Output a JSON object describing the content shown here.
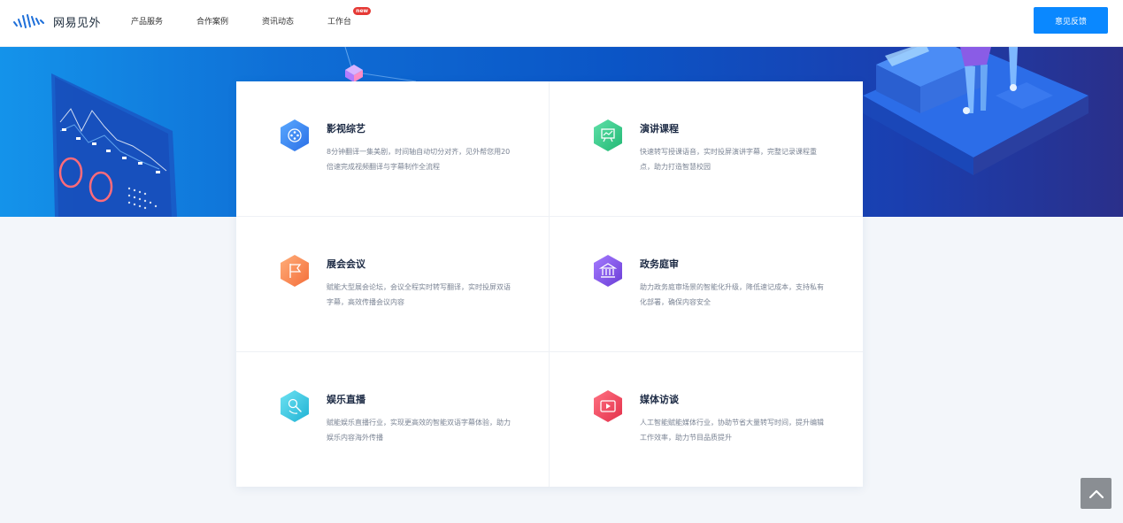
{
  "header": {
    "logo_text": "网易见外",
    "nav": [
      {
        "label": "产品服务"
      },
      {
        "label": "合作案例"
      },
      {
        "label": "资讯动态"
      },
      {
        "label": "工作台",
        "badge": "new"
      }
    ],
    "feedback_label": "意见反馈"
  },
  "cards": [
    {
      "title": "影视综艺",
      "desc": "8分钟翻译一集美剧，时间轴自动切分对齐，见外帮您用20倍速完成视频翻译与字幕制作全流程",
      "icon": "film-reel-icon",
      "color": "#3d8cf0"
    },
    {
      "title": "演讲课程",
      "desc": "快速转写授课语音，实时投屏演讲字幕，完整记录课程重点，助力打造智慧校园",
      "icon": "presentation-board-icon",
      "color": "#3ccf8e"
    },
    {
      "title": "展会会议",
      "desc": "赋能大型展会论坛，会议全程实时转写翻译，实时投屏双语字幕，高效传播会议内容",
      "icon": "flag-icon",
      "color": "#f98a55"
    },
    {
      "title": "政务庭审",
      "desc": "助力政务庭审场景的智能化升级，降低速记成本，支持私有化部署，确保内容安全",
      "icon": "courthouse-icon",
      "color": "#8656e6"
    },
    {
      "title": "娱乐直播",
      "desc": "赋能娱乐直播行业，实现更高效的智能双语字幕体验，助力娱乐内容海外传播",
      "icon": "live-stream-icon",
      "color": "#36c6e0"
    },
    {
      "title": "媒体访谈",
      "desc": "人工智能赋能媒体行业，协助节省大量转写时间，提升编辑工作效率，助力节目品质提升",
      "icon": "media-player-icon",
      "color": "#ef4a5c"
    }
  ],
  "back_to_top": "chevron-up-icon"
}
